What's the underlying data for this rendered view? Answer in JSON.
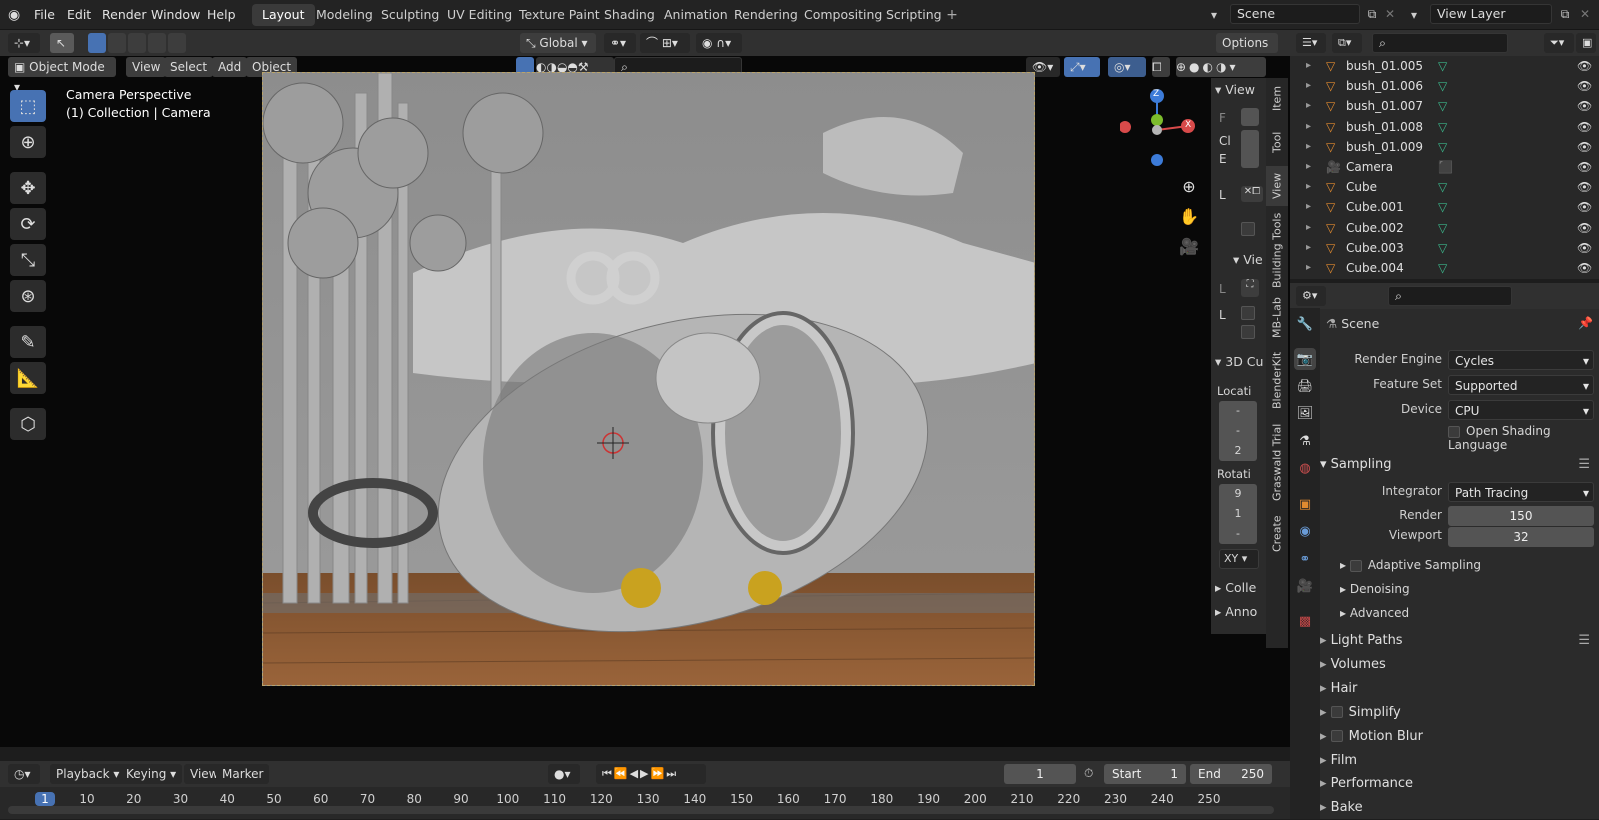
{
  "menus": [
    "File",
    "Edit",
    "Render",
    "Window",
    "Help"
  ],
  "workspaces": [
    "Layout",
    "Modeling",
    "Sculpting",
    "UV Editing",
    "Texture Paint",
    "Shading",
    "Animation",
    "Rendering",
    "Compositing",
    "Scripting"
  ],
  "active_workspace": "Layout",
  "scene_name": "Scene",
  "view_layer_name": "View Layer",
  "header": {
    "transform_orientation": "Global",
    "options_label": "Options"
  },
  "viewport_header": {
    "mode": "Object Mode",
    "view": "View",
    "select": "Select",
    "add": "Add",
    "object": "Object"
  },
  "viewport_overlay": {
    "line1": "Camera Perspective",
    "line2": "(1) Collection | Camera"
  },
  "npanel": {
    "view_header": "View",
    "view_header2": "Vie",
    "cursor_header": "3D Cu",
    "location_label": "Locati",
    "loc_values": [
      "-",
      "-",
      "2"
    ],
    "rotation_label": "Rotati",
    "rot_values": [
      "9",
      "1",
      "-"
    ],
    "rot_mode": "XY",
    "collections_label": "Colle",
    "annotations_label": "Anno",
    "letters": [
      "F",
      "Cl",
      "E",
      "L",
      "L",
      "L"
    ]
  },
  "ntabs": [
    "Item",
    "Tool",
    "View",
    "Building Tools",
    "MB-Lab",
    "BlenderKit",
    "Graswald Trial",
    "Create"
  ],
  "ntab_active": "View",
  "outliner": {
    "rows": [
      {
        "name": "bush_01.005",
        "type": "mesh"
      },
      {
        "name": "bush_01.006",
        "type": "mesh"
      },
      {
        "name": "bush_01.007",
        "type": "mesh"
      },
      {
        "name": "bush_01.008",
        "type": "mesh"
      },
      {
        "name": "bush_01.009",
        "type": "mesh"
      },
      {
        "name": "Camera",
        "type": "camera"
      },
      {
        "name": "Cube",
        "type": "mesh"
      },
      {
        "name": "Cube.001",
        "type": "mesh"
      },
      {
        "name": "Cube.002",
        "type": "mesh"
      },
      {
        "name": "Cube.003",
        "type": "mesh"
      },
      {
        "name": "Cube.004",
        "type": "mesh"
      }
    ]
  },
  "properties": {
    "context": "Scene",
    "render_engine_label": "Render Engine",
    "render_engine": "Cycles",
    "feature_set_label": "Feature Set",
    "feature_set": "Supported",
    "device_label": "Device",
    "device": "CPU",
    "osl_label": "Open Shading Language",
    "sampling_label": "Sampling",
    "integrator_label": "Integrator",
    "integrator": "Path Tracing",
    "render_label": "Render",
    "render_samples": "150",
    "viewport_label": "Viewport",
    "viewport_samples": "32",
    "adaptive_label": "Adaptive Sampling",
    "denoising_label": "Denoising",
    "advanced_label": "Advanced",
    "sections": [
      "Light Paths",
      "Volumes",
      "Hair",
      "Simplify",
      "Motion Blur",
      "Film",
      "Performance",
      "Bake"
    ]
  },
  "timeline": {
    "playback": "Playback",
    "keying": "Keying",
    "view": "View",
    "marker": "Marker",
    "current_frame": "1",
    "start_label": "Start",
    "start": "1",
    "end_label": "End",
    "end": "250",
    "ticks": [
      "1",
      "10",
      "20",
      "30",
      "40",
      "50",
      "60",
      "70",
      "80",
      "90",
      "100",
      "110",
      "120",
      "130",
      "140",
      "150",
      "160",
      "170",
      "180",
      "190",
      "200",
      "210",
      "220",
      "230",
      "240",
      "250"
    ]
  },
  "gizmo": {
    "z": "Z",
    "x": "X"
  }
}
